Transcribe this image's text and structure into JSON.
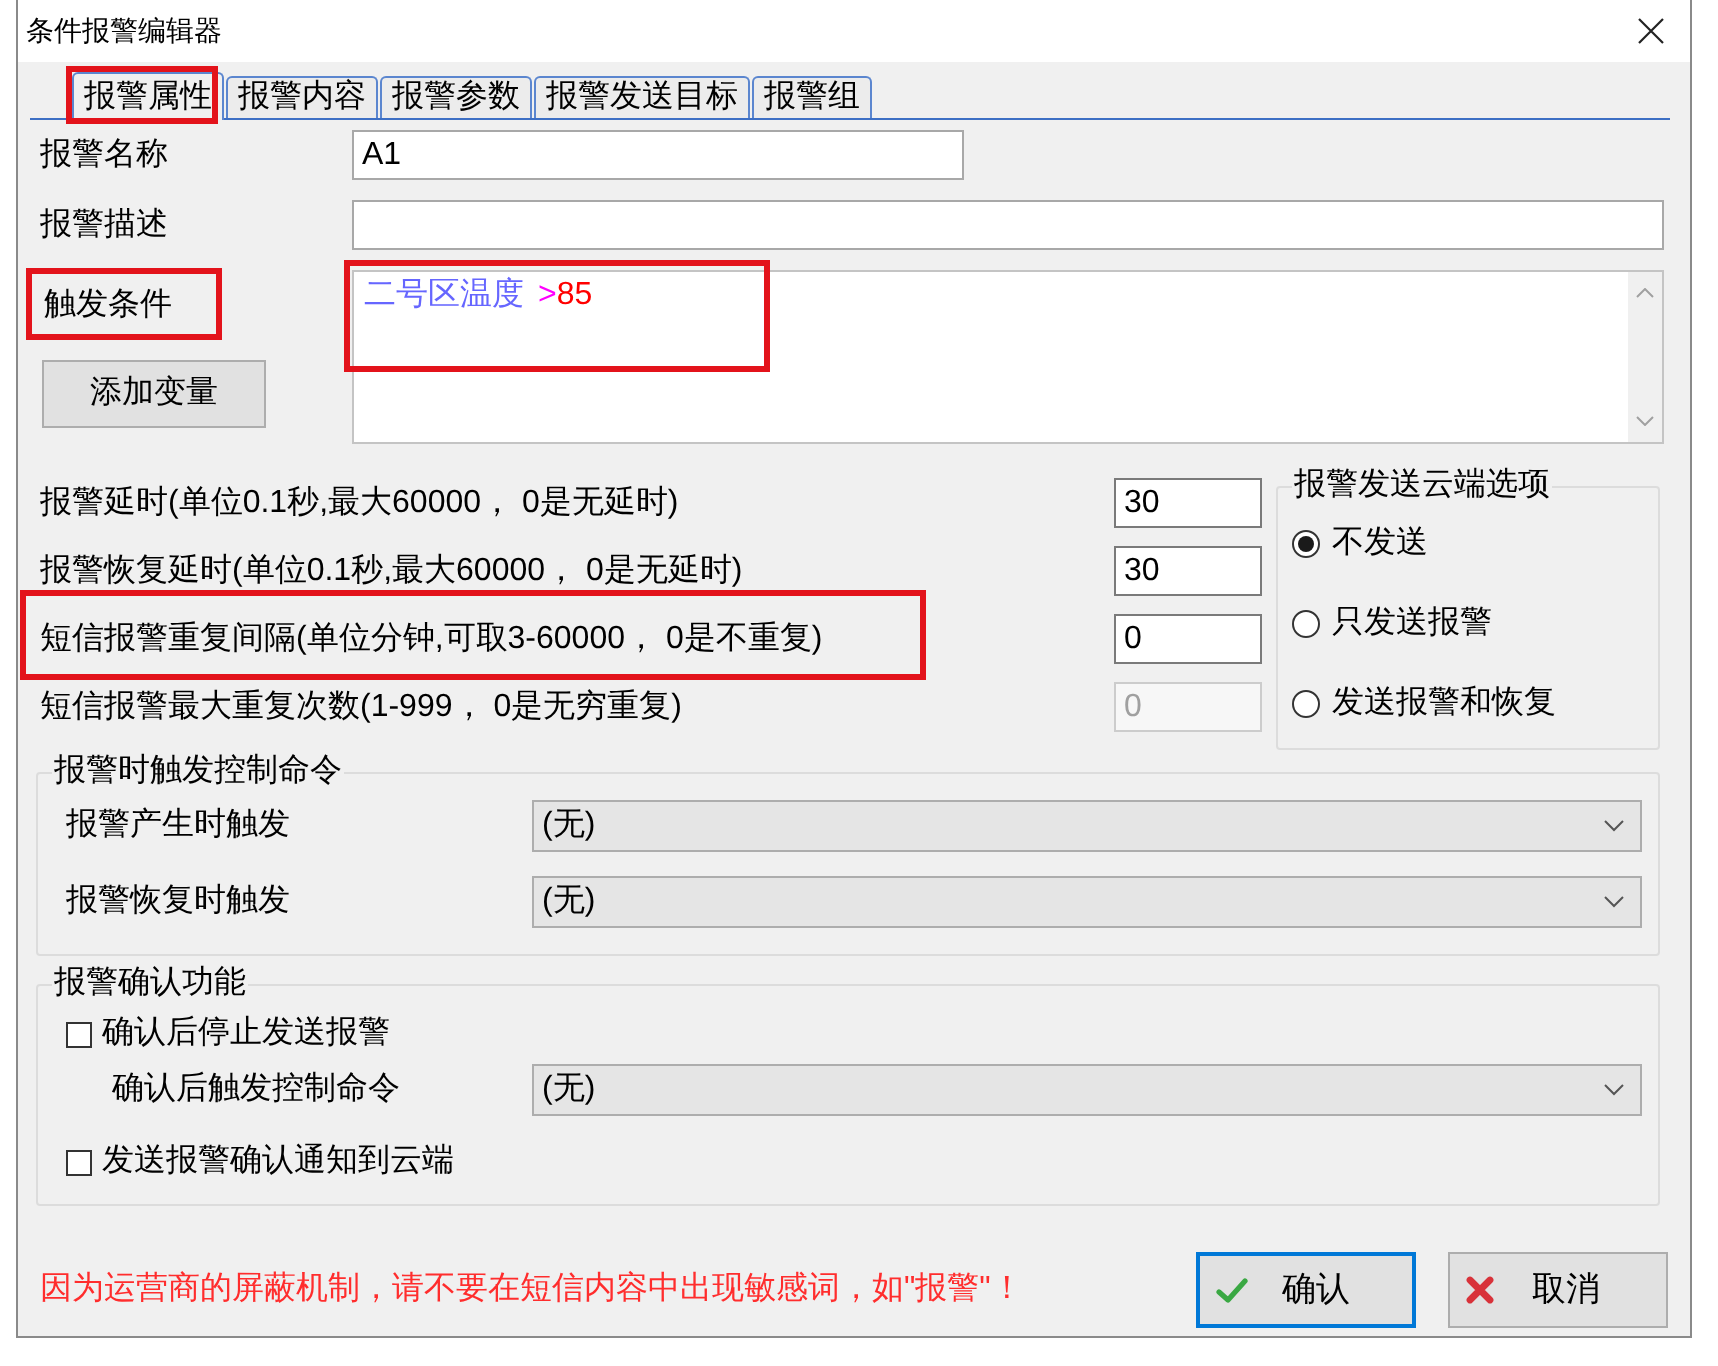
{
  "window": {
    "title": "条件报警编辑器"
  },
  "tabs": [
    {
      "label": "报警属性",
      "selected": true,
      "highlighted": true
    },
    {
      "label": "报警内容",
      "selected": false,
      "highlighted": false
    },
    {
      "label": "报警参数",
      "selected": false,
      "highlighted": false
    },
    {
      "label": "报警发送目标",
      "selected": false,
      "highlighted": false
    },
    {
      "label": "报警组",
      "selected": false,
      "highlighted": false
    }
  ],
  "fields": [
    {
      "label": "报警名称",
      "value": "A1"
    },
    {
      "label": "报警描述"
    }
  ],
  "condition": {
    "label": "触发条件",
    "label_highlighted": true,
    "tokens": [
      {
        "kind": "variable",
        "text": "二号区温度",
        "color": "#6666ff"
      },
      {
        "kind": "operator",
        "text": ">",
        "color": "#ff00ff"
      },
      {
        "kind": "number",
        "text": "85",
        "color": "#ff0000"
      }
    ],
    "value_highlighted": true,
    "button": "添加变量"
  },
  "timing_rows": [
    {
      "label": "报警延时(单位0.1秒,最大60000， 0是无延时)",
      "value": "30",
      "disabled": false,
      "highlighted": false
    },
    {
      "label": "报警恢复延时(单位0.1秒,最大60000， 0是无延时)",
      "value": "30",
      "disabled": false,
      "highlighted": false
    },
    {
      "label": "短信报警重复间隔(单位分钟,可取3-60000， 0是不重复)",
      "value": "0",
      "disabled": false,
      "highlighted": true
    },
    {
      "label": "短信报警最大重复次数(1-999， 0是无穷重复)",
      "value": "0",
      "disabled": true,
      "highlighted": false
    }
  ],
  "cloud_options": {
    "title": "报警发送云端选项",
    "options": [
      {
        "label": "不发送",
        "selected": true
      },
      {
        "label": "只发送报警",
        "selected": false
      },
      {
        "label": "发送报警和恢复",
        "selected": false
      }
    ]
  },
  "trigger_commands": {
    "title": "报警时触发控制命令",
    "rows": [
      {
        "label": "报警产生时触发",
        "value": "(无)"
      },
      {
        "label": "报警恢复时触发",
        "value": "(无)"
      }
    ]
  },
  "confirmation": {
    "title": "报警确认功能",
    "items": [
      {
        "kind": "checkbox",
        "label": "确认后停止发送报警",
        "checked": false
      },
      {
        "kind": "select",
        "label": "确认后触发控制命令",
        "value": "(无)"
      },
      {
        "kind": "checkbox",
        "label": "发送报警确认通知到云端",
        "checked": false
      }
    ]
  },
  "notice": "因为运营商的屏蔽机制，请不要在短信内容中出现敏感词，如\"报警\"！",
  "buttons": [
    {
      "kind": "ok",
      "label": "确认",
      "default": true
    },
    {
      "kind": "cancel",
      "label": "取消",
      "default": false
    }
  ]
}
